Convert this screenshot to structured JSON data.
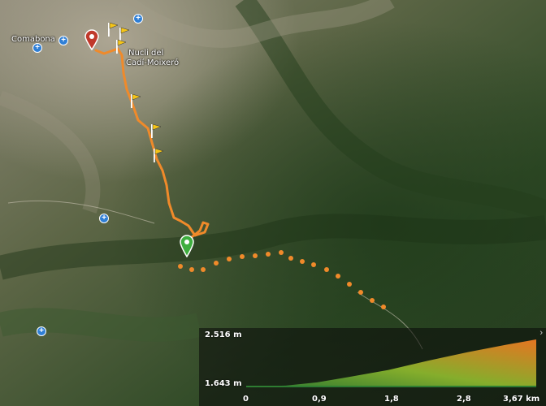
{
  "map": {
    "place_labels": {
      "comabona": "Comabona",
      "nucli": "Nucli del",
      "cadi": "Cadí-Moixeró"
    }
  },
  "elevation_profile": {
    "max_label": "2.516 m",
    "min_label": "1.643 m",
    "x_ticks": [
      "0",
      "0,9",
      "1,8",
      "2,8",
      "3,67 km"
    ],
    "collapse_icon": "chevron-right-icon"
  },
  "colors": {
    "track": "#f08a2a",
    "start_marker": "#3fae3f",
    "end_marker": "#c0392b",
    "poi": "#2f7fd6"
  },
  "chart_data": {
    "type": "area",
    "x": [
      0,
      0.5,
      0.9,
      1.3,
      1.8,
      2.3,
      2.8,
      3.3,
      3.67
    ],
    "values": [
      1643,
      1660,
      1720,
      1820,
      1950,
      2120,
      2280,
      2420,
      2516
    ],
    "xlabel": "",
    "ylabel": "",
    "ylim": [
      1643,
      2516
    ],
    "xlim": [
      0,
      3.67
    ],
    "x_unit": "km",
    "y_unit": "m"
  }
}
